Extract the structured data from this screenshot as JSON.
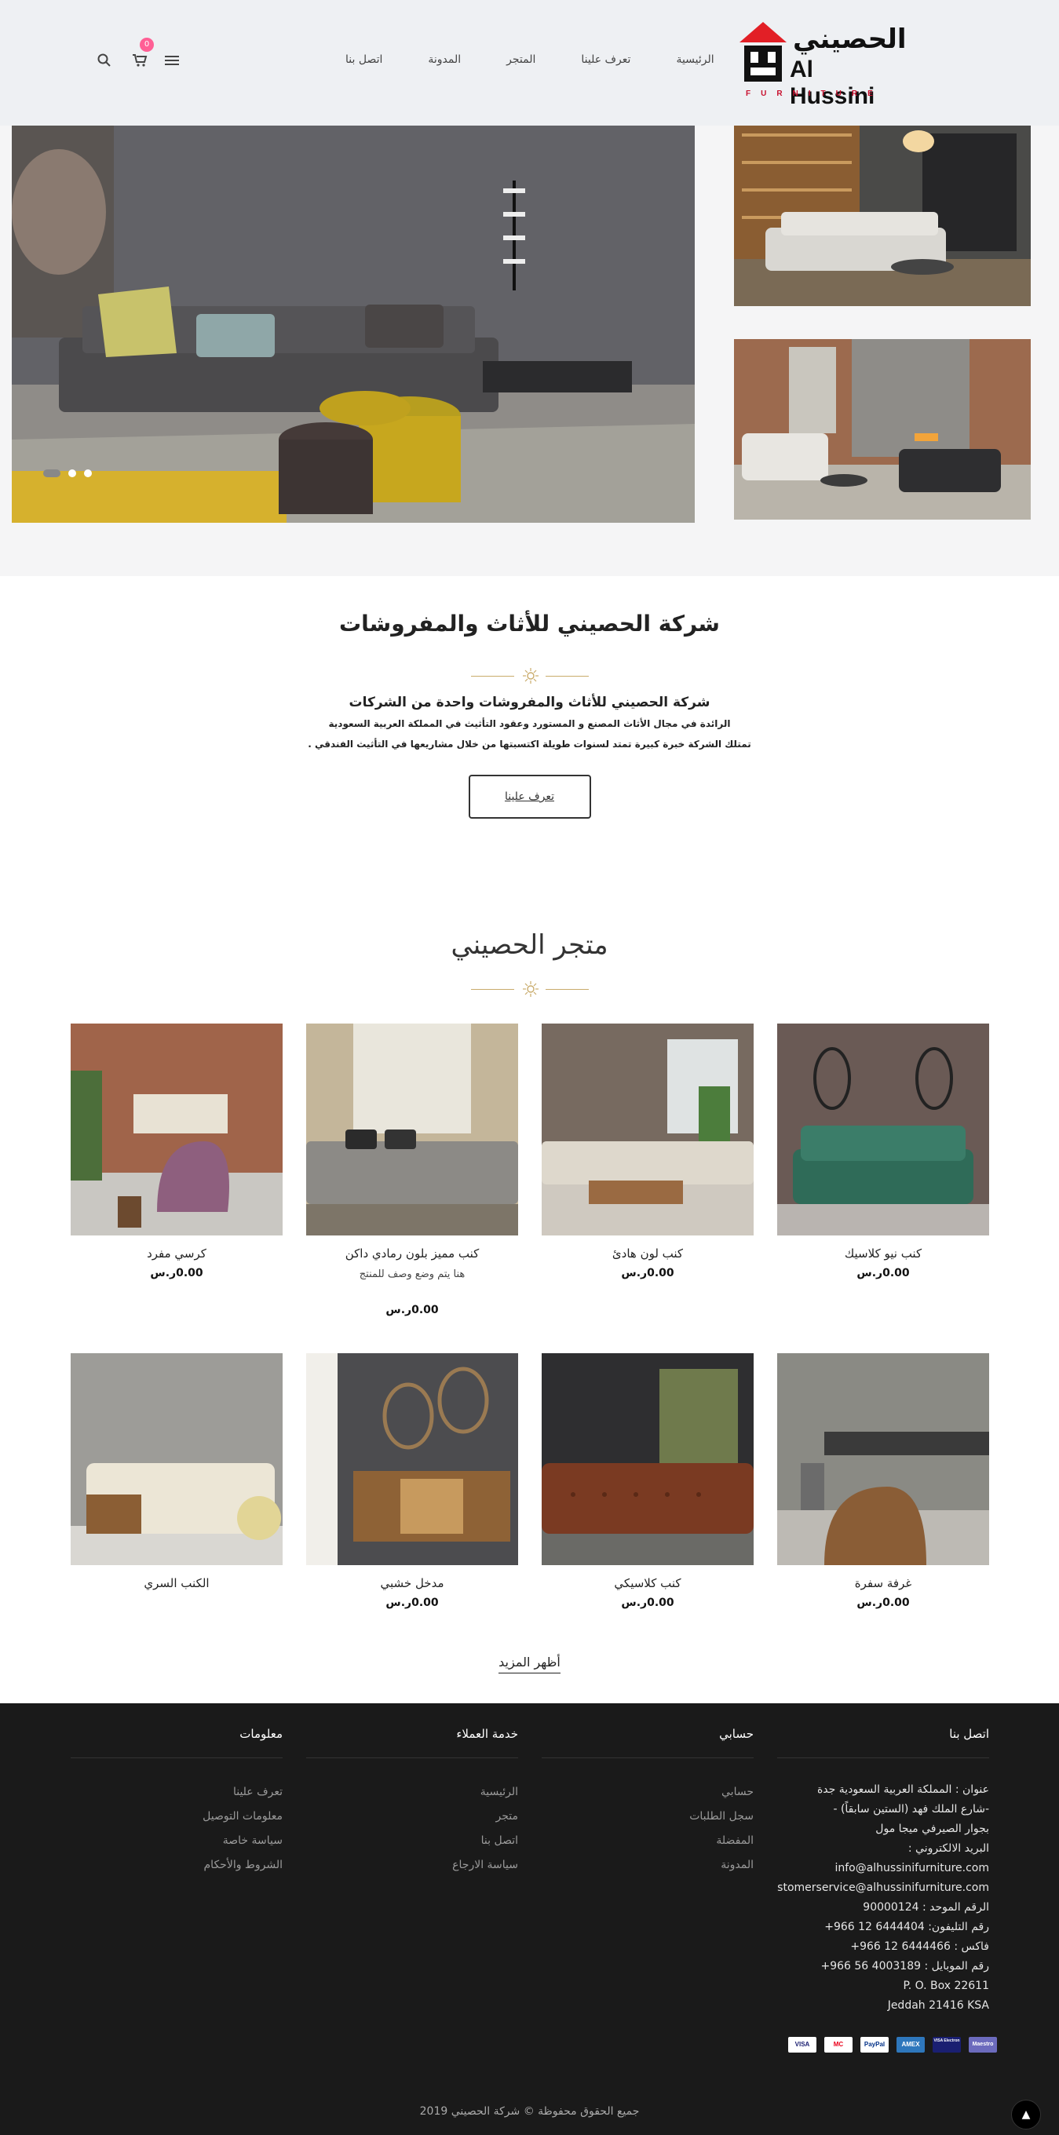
{
  "brand": {
    "name_ar": "الحصيني",
    "name_en": "Al Hussini",
    "tagline": "FURNITURE",
    "red": "#e21f26",
    "dark": "#111111"
  },
  "nav": {
    "items": [
      "الرئيسية",
      "تعرف علينا",
      "المتجر",
      "المدونة",
      "اتصل بنا"
    ]
  },
  "header_icons": {
    "menu": "menu-icon",
    "cart": "cart-icon",
    "search": "search-icon",
    "cart_count": "0"
  },
  "hero": {
    "dots": 3,
    "active_dot": 1
  },
  "about": {
    "title": "شركة الحصيني للأثاث والمفروشات",
    "subtitle": "شركة الحصيني للأثاث والمفروشات واحدة من الشركات",
    "line1": "الرائدة في مجال الأثاث المصنع و المستورد وعقود التأثيث في المملكة العربية السعودية",
    "line2": "تمتلك الشركة خبرة كبيرة تمتد لسنوات طويلة اكتسبتها من خلال مشاريعها في التأثيث الفندقي .",
    "button": "تعرف علينا",
    "accent": "#c9ab6b"
  },
  "store": {
    "title": "متجر الحصيني",
    "products": [
      {
        "name": "كنب نيو كلاسيك",
        "price": "0.00ر.س",
        "desc": ""
      },
      {
        "name": "كنب لون هادئ",
        "price": "0.00ر.س",
        "desc": ""
      },
      {
        "name": "كنب مميز بلون رمادي داكن",
        "price": "0.00ر.س",
        "desc": "هنا يتم وضع وصف للمنتج"
      },
      {
        "name": "كرسي مفرد",
        "price": "0.00ر.س",
        "desc": ""
      },
      {
        "name": "غرفة سفرة",
        "price": "0.00ر.س",
        "desc": ""
      },
      {
        "name": "كنب كلاسيكي",
        "price": "0.00ر.س",
        "desc": ""
      },
      {
        "name": "مدخل خشبي",
        "price": "0.00ر.س",
        "desc": ""
      },
      {
        "name": "الكنب السري",
        "price": "",
        "desc": ""
      }
    ],
    "show_more": "أظهر المزيد"
  },
  "footer": {
    "contact": {
      "title": "اتصل بنا",
      "lines": [
        "عنوان : المملكة العربية السعودية جدة",
        "-شارع الملك فهد (الستين سابقاً) -",
        "بجوار الصيرفي ميجا مول",
        "البريد الالكتروني :",
        "info@alhussinifurniture.com",
        "customerservice@alhussinifurniture.com",
        "الرقم الموحد : 90000124",
        "رقم التليفون:  6444404 12 966+",
        "فاكس :  6444466 12 966+",
        "رقم الموبايل :  4003189 56 966+",
        "P. O. Box 22611",
        "Jeddah 21416 KSA"
      ]
    },
    "account": {
      "title": "حسابي",
      "items": [
        "حسابي",
        "سجل الطلبات",
        "المفضلة",
        "المدونة"
      ]
    },
    "service": {
      "title": "خدمة العملاء",
      "items": [
        "الرئيسية",
        "متجر",
        "اتصل بنا",
        "سياسة الارجاع"
      ]
    },
    "info": {
      "title": "معلومات",
      "items": [
        "تعرف علينا",
        "معلومات التوصيل",
        "سياسة خاصة",
        "الشروط والأحكام"
      ]
    },
    "payments": [
      "VISA",
      "MC",
      "PayPal",
      "AMEX",
      "VISA Electron",
      "Maestro"
    ],
    "copyright": "جميع الحقوق محفوظة  ©  شركة الحصيني 2019"
  }
}
